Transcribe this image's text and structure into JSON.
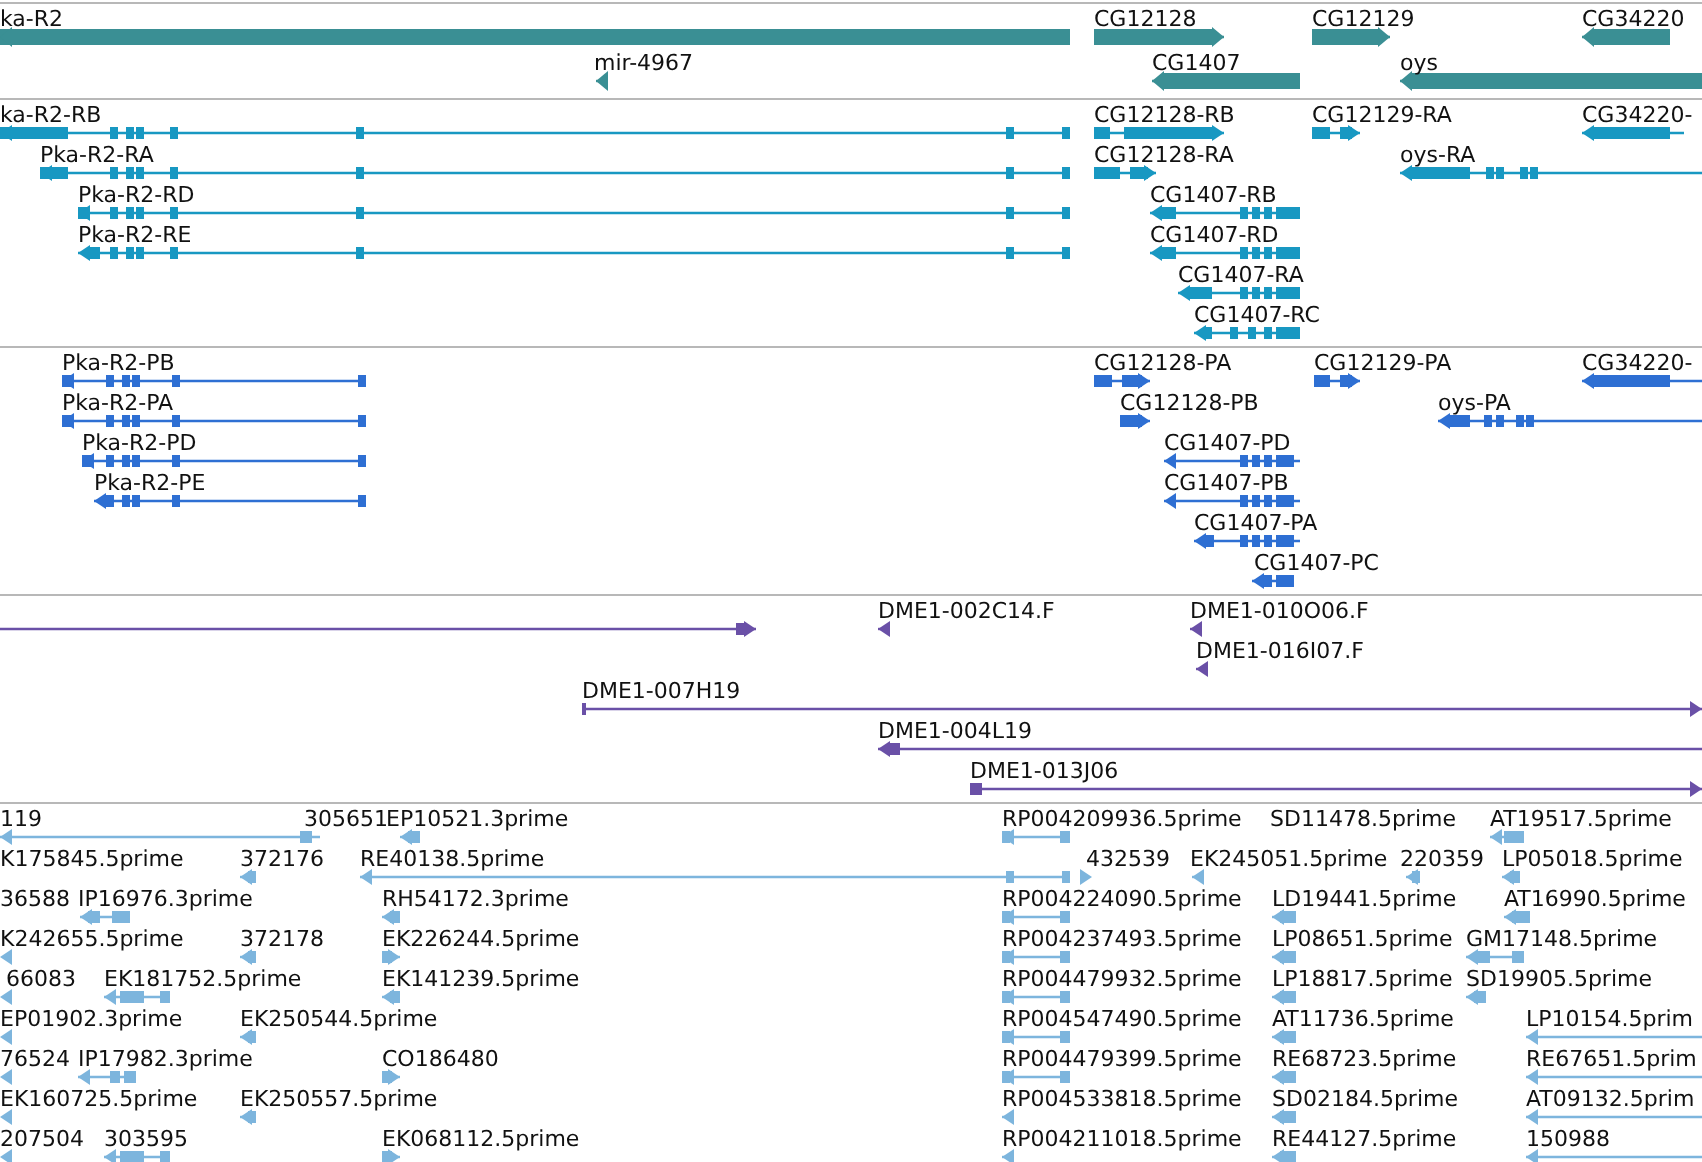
{
  "tracks": [
    {
      "kind": "gene",
      "features": [
        {
          "label": "ka-R2",
          "reverse": true
        },
        {
          "label": "CG12128",
          "reverse": false
        },
        {
          "label": "CG12129",
          "reverse": false
        },
        {
          "label": "CG34220",
          "reverse": true
        },
        {
          "label": "mir-4967",
          "reverse": true
        },
        {
          "label": "CG1407",
          "reverse": true
        },
        {
          "label": "oys",
          "reverse": true
        }
      ]
    },
    {
      "kind": "mrna",
      "features": [
        {
          "label": "ka-R2-RB",
          "reverse": true
        },
        {
          "label": "CG12128-RB",
          "reverse": false
        },
        {
          "label": "CG12129-RA",
          "reverse": false
        },
        {
          "label": "CG34220-",
          "reverse": true
        },
        {
          "label": "Pka-R2-RA",
          "reverse": true
        },
        {
          "label": "CG12128-RA",
          "reverse": false
        },
        {
          "label": "oys-RA",
          "reverse": true
        },
        {
          "label": "Pka-R2-RD",
          "reverse": true
        },
        {
          "label": "CG1407-RB",
          "reverse": true
        },
        {
          "label": "Pka-R2-RE",
          "reverse": true
        },
        {
          "label": "CG1407-RD",
          "reverse": true
        },
        {
          "label": "CG1407-RA",
          "reverse": true
        },
        {
          "label": "CG1407-RC",
          "reverse": true
        }
      ]
    },
    {
      "kind": "protein",
      "features": [
        {
          "label": "Pka-R2-PB",
          "reverse": true
        },
        {
          "label": "CG12128-PA",
          "reverse": false
        },
        {
          "label": "CG12129-PA",
          "reverse": false
        },
        {
          "label": "CG34220-",
          "reverse": true
        },
        {
          "label": "Pka-R2-PA",
          "reverse": true
        },
        {
          "label": "CG12128-PB",
          "reverse": false
        },
        {
          "label": "oys-PA",
          "reverse": true
        },
        {
          "label": "Pka-R2-PD",
          "reverse": true
        },
        {
          "label": "CG1407-PD",
          "reverse": true
        },
        {
          "label": "Pka-R2-PE",
          "reverse": true
        },
        {
          "label": "CG1407-PB",
          "reverse": true
        },
        {
          "label": "CG1407-PA",
          "reverse": true
        },
        {
          "label": "CG1407-PC",
          "reverse": true
        }
      ]
    },
    {
      "kind": "clone",
      "features": [
        {
          "reverse": false
        },
        {
          "label": "DME1-002C14.F",
          "reverse": true
        },
        {
          "label": "DME1-010O06.F",
          "reverse": true
        },
        {
          "label": "DME1-016I07.F",
          "reverse": true
        },
        {
          "label": "DME1-007H19",
          "reverse": false
        },
        {
          "label": "DME1-004L19",
          "reverse": true
        },
        {
          "label": "DME1-013J06",
          "reverse": false
        }
      ]
    },
    {
      "kind": "est",
      "features": [
        {
          "label": "119"
        },
        {
          "label": "305651",
          "reverse": true
        },
        {
          "label": "EP10521.3prime",
          "reverse": true
        },
        {
          "label": "RP004209936.5prime",
          "reverse": true
        },
        {
          "label": "SD11478.5prime"
        },
        {
          "label": "AT19517.5prime",
          "reverse": true
        },
        {
          "label": "K175845.5prime"
        },
        {
          "label": "372176",
          "reverse": true
        },
        {
          "label": "RE40138.5prime",
          "reverse": true
        },
        {
          "label": "432539",
          "reverse": false
        },
        {
          "label": "EK245051.5prime",
          "reverse": true
        },
        {
          "label": "220359",
          "reverse": true
        },
        {
          "label": "LP05018.5prime",
          "reverse": true
        },
        {
          "label": "36588"
        },
        {
          "label": "IP16976.3prime",
          "reverse": true
        },
        {
          "label": "RH54172.3prime",
          "reverse": true
        },
        {
          "label": "RP004224090.5prime",
          "reverse": true
        },
        {
          "label": "LD19441.5prime",
          "reverse": true
        },
        {
          "label": "AT16990.5prime",
          "reverse": true
        },
        {
          "label": "K242655.5prime",
          "reverse": true
        },
        {
          "label": "372178",
          "reverse": true
        },
        {
          "label": "EK226244.5prime",
          "reverse": false
        },
        {
          "label": "RP004237493.5prime",
          "reverse": true
        },
        {
          "label": "LP08651.5prime",
          "reverse": true
        },
        {
          "label": "GM17148.5prime",
          "reverse": true
        },
        {
          "label": "66083",
          "reverse": true
        },
        {
          "label": "EK181752.5prime",
          "reverse": true
        },
        {
          "label": "EK141239.5prime",
          "reverse": true
        },
        {
          "label": "RP004479932.5prime",
          "reverse": true
        },
        {
          "label": "LP18817.5prime",
          "reverse": true
        },
        {
          "label": "SD19905.5prime",
          "reverse": true
        },
        {
          "label": "EP01902.3prime",
          "reverse": true
        },
        {
          "label": "EK250544.5prime",
          "reverse": true
        },
        {
          "label": "RP004547490.5prime",
          "reverse": true
        },
        {
          "label": "AT11736.5prime",
          "reverse": true
        },
        {
          "label": "LP10154.5prim",
          "reverse": true
        },
        {
          "label": "76524",
          "reverse": true
        },
        {
          "label": "IP17982.3prime",
          "reverse": true
        },
        {
          "label": "CO186480",
          "reverse": false
        },
        {
          "label": "RP004479399.5prime",
          "reverse": true
        },
        {
          "label": "RE68723.5prime",
          "reverse": true
        },
        {
          "label": "RE67651.5prim",
          "reverse": true
        },
        {
          "label": "EK160725.5prime",
          "reverse": true
        },
        {
          "label": "EK250557.5prime",
          "reverse": true
        },
        {
          "label": "RP004533818.5prime",
          "reverse": true
        },
        {
          "label": "SD02184.5prime",
          "reverse": true
        },
        {
          "label": "AT09132.5prim",
          "reverse": true
        },
        {
          "label": "207504",
          "reverse": true
        },
        {
          "label": "303595",
          "reverse": true
        },
        {
          "label": "EK068112.5prime",
          "reverse": false
        },
        {
          "label": "RP004211018.5prime",
          "reverse": true
        },
        {
          "label": "RE44127.5prime",
          "reverse": true
        },
        {
          "label": "150988",
          "reverse": true
        }
      ]
    }
  ]
}
